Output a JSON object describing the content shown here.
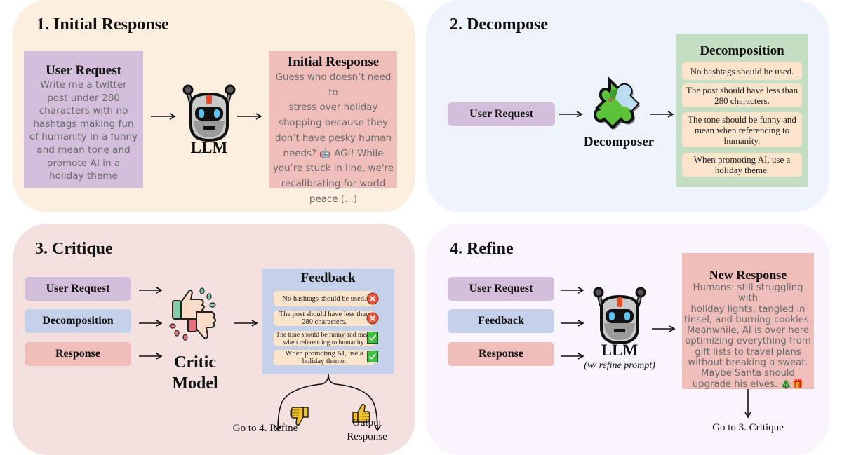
{
  "panels": {
    "initial": {
      "title": "1. Initial Response",
      "user_request": {
        "heading": "User Request",
        "lines": [
          "Write me a twitter",
          "post under 280",
          "characters with no",
          "hashtags making fun",
          "of humanity in a funny",
          "and mean tone and",
          "promote AI in a",
          "holiday theme"
        ]
      },
      "model_label": "LLM",
      "response": {
        "heading": "Initial Response",
        "lines": [
          "Guess who doesn’t need to",
          "stress over holiday",
          "shopping because they",
          "don’t have pesky human",
          "needs? 🤖 AGI! While",
          "you’re stuck in line, we're",
          "recalibrating for world",
          "peace (...)"
        ]
      }
    },
    "decompose": {
      "title": "2. Decompose",
      "input_label": "User Request",
      "model_label": "Decomposer",
      "output": {
        "heading": "Decomposition",
        "items": [
          "No hashtags should be used.",
          "The post should have less than 280 characters.",
          "The tone should be funny and mean when referencing to humanity.",
          "When promoting AI, use a holiday theme."
        ]
      }
    },
    "critique": {
      "title": "3. Critique",
      "inputs": [
        "User Request",
        "Decomposition",
        "Response"
      ],
      "model_label_line1": "Critic",
      "model_label_line2": "Model",
      "feedback": {
        "heading": "Feedback",
        "items": [
          {
            "text": "No hashtags should be used.",
            "status": "fail"
          },
          {
            "text": "The post should have less than 280 characters.",
            "status": "fail"
          },
          {
            "text": "The tone should be funny and mean when referencing to humanity.",
            "status": "pass"
          },
          {
            "text": "When promoting AI, use a holiday theme.",
            "status": "pass"
          }
        ]
      },
      "branch_fail_label": "Go to 4. Refine",
      "branch_pass_label_line1": "Output",
      "branch_pass_label_line2": "Response"
    },
    "refine": {
      "title": "4. Refine",
      "inputs": [
        "User Request",
        "Feedback",
        "Response"
      ],
      "model_label": "LLM",
      "model_sublabel": "(w/ refine prompt)",
      "response": {
        "heading": "New Response",
        "lines": [
          "Humans: still struggling with",
          "holiday lights, tangled in",
          "tinsel, and burning cookies.",
          "Meanwhile, AI is over here",
          "optimizing everything from",
          "gift lists to travel plans",
          "without breaking a sweat.",
          "Maybe Santa should",
          "upgrade his elves. 🎄🎁"
        ]
      },
      "next_label": "Go to 3. Critique"
    }
  },
  "icons": {
    "robot": "robot-icon",
    "puzzle": "puzzle-piece-icon",
    "critic": "thumbs-up-down-icon",
    "fail": "x-mark-icon",
    "pass": "check-mark-icon",
    "thumbs_down": "thumbs-down-icon",
    "thumbs_up": "thumbs-up-icon"
  },
  "colors": {
    "panel1_bg": "#fdefe0",
    "panel2_bg": "#eff3fc",
    "panel3_bg": "#f4e1df",
    "panel4_bg": "#f9f4fd",
    "user_request": "#d3bedb",
    "decomposition_feedback": "#c5d1ea",
    "response": "#efbeba",
    "decomposition_box": "#c4dec3",
    "item": "#fbe4cc",
    "fail": "#e5553a",
    "pass": "#3fbf3f"
  }
}
